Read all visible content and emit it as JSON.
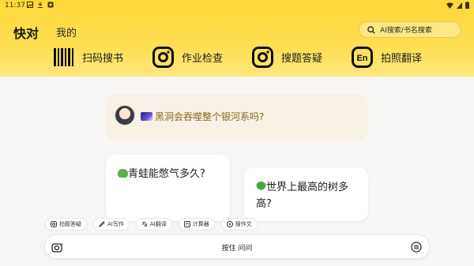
{
  "status_bar": {
    "time": "11:37"
  },
  "header": {
    "app_title": "快对",
    "tab_mine": "我的",
    "search_placeholder": "AI搜索/书名搜索"
  },
  "tools": [
    {
      "label": "扫码搜书",
      "icon": "barcode-icon"
    },
    {
      "label": "作业检查",
      "icon": "camera-icon"
    },
    {
      "label": "搜题答疑",
      "icon": "camera-icon"
    },
    {
      "label": "拍照翻译",
      "icon": "translate-icon"
    }
  ],
  "feed": {
    "top_question": "黑洞会吞噬整个银河系吗?",
    "card_1_question": "青蛙能憋气多久?",
    "card_2_question": "世界上最高的树多高?"
  },
  "chips": [
    "拍题答疑",
    "AI写作",
    "AI翻译",
    "计算器",
    "搜作文"
  ],
  "input": {
    "hold_label": "按住 问问"
  },
  "colors": {
    "accent": "#ffd93a",
    "question_text": "#8a6a1c"
  }
}
